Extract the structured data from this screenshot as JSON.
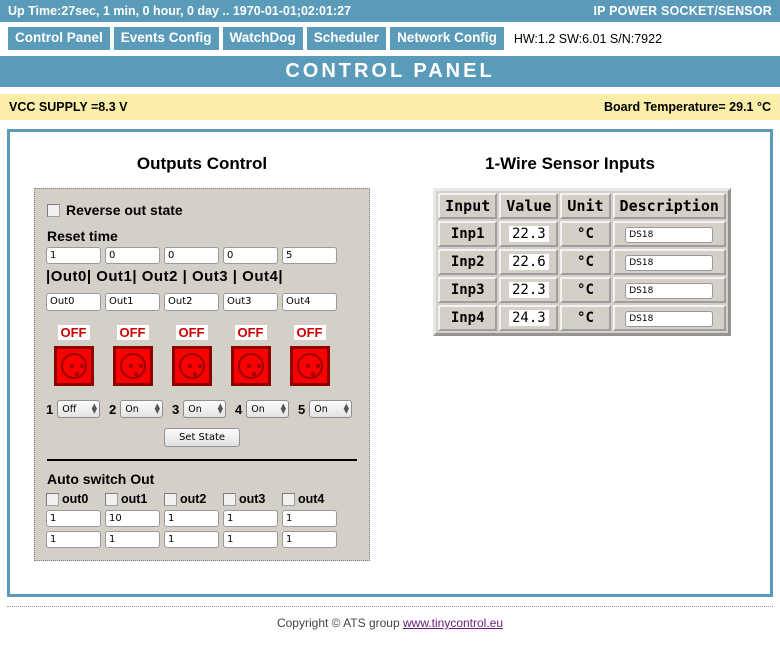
{
  "topbar": {
    "uptime": "Up Time:27sec, 1 min, 0 hour, 0 day .. 1970-01-01;02:01:27",
    "brand": "IP POWER SOCKET/SENSOR"
  },
  "nav": {
    "tabs": [
      {
        "label": "Control Panel"
      },
      {
        "label": "Events Config"
      },
      {
        "label": "WatchDog"
      },
      {
        "label": "Scheduler"
      },
      {
        "label": "Network Config"
      }
    ],
    "version_info": "HW:1.2 SW:6.01 S/N:7922"
  },
  "page_title": "CONTROL PANEL",
  "status_band": {
    "vcc": "VCC SUPPLY =8.3 V",
    "board_temp": "Board Temperature= 29.1 °C"
  },
  "outputs": {
    "title": "Outputs Control",
    "reverse_label": "Reverse out state",
    "reverse_checked": false,
    "reset_time_label": "Reset time",
    "reset_times": [
      "1",
      "0",
      "0",
      "0",
      "5"
    ],
    "out_headers": "|Out0| Out1| Out2 | Out3 | Out4|",
    "names": [
      "Out0",
      "Out1",
      "Out2",
      "Out3",
      "Out4"
    ],
    "states": [
      "OFF",
      "OFF",
      "OFF",
      "OFF",
      "OFF"
    ],
    "selectors": [
      {
        "num": "1",
        "value": "Off"
      },
      {
        "num": "2",
        "value": "On"
      },
      {
        "num": "3",
        "value": "On"
      },
      {
        "num": "4",
        "value": "On"
      },
      {
        "num": "5",
        "value": "On"
      }
    ],
    "set_state_label": "Set State",
    "auto_switch": {
      "title": "Auto switch Out",
      "checkboxes": [
        {
          "label": "out0",
          "checked": false
        },
        {
          "label": "out1",
          "checked": false
        },
        {
          "label": "out2",
          "checked": false
        },
        {
          "label": "out3",
          "checked": false
        },
        {
          "label": "out4",
          "checked": false
        }
      ],
      "row1": [
        "1",
        "10",
        "1",
        "1",
        "1"
      ],
      "row2": [
        "1",
        "1",
        "1",
        "1",
        "1"
      ]
    }
  },
  "sensors": {
    "title": "1-Wire Sensor Inputs",
    "columns": [
      "Input",
      "Value",
      "Unit",
      "Description"
    ],
    "rows": [
      {
        "input": "Inp1",
        "value": "22.3",
        "unit": "°C",
        "description": "DS18"
      },
      {
        "input": "Inp2",
        "value": "22.6",
        "unit": "°C",
        "description": "DS18"
      },
      {
        "input": "Inp3",
        "value": "22.3",
        "unit": "°C",
        "description": "DS18"
      },
      {
        "input": "Inp4",
        "value": "24.3",
        "unit": "°C",
        "description": "DS18"
      }
    ]
  },
  "footer": {
    "text": "Copyright © ATS group ",
    "link": "www.tinycontrol.eu"
  },
  "colors": {
    "accent": "#5b9bba",
    "status_band": "#fbeea8",
    "socket_red": "#fb0000",
    "state_off": "#cc0000"
  }
}
